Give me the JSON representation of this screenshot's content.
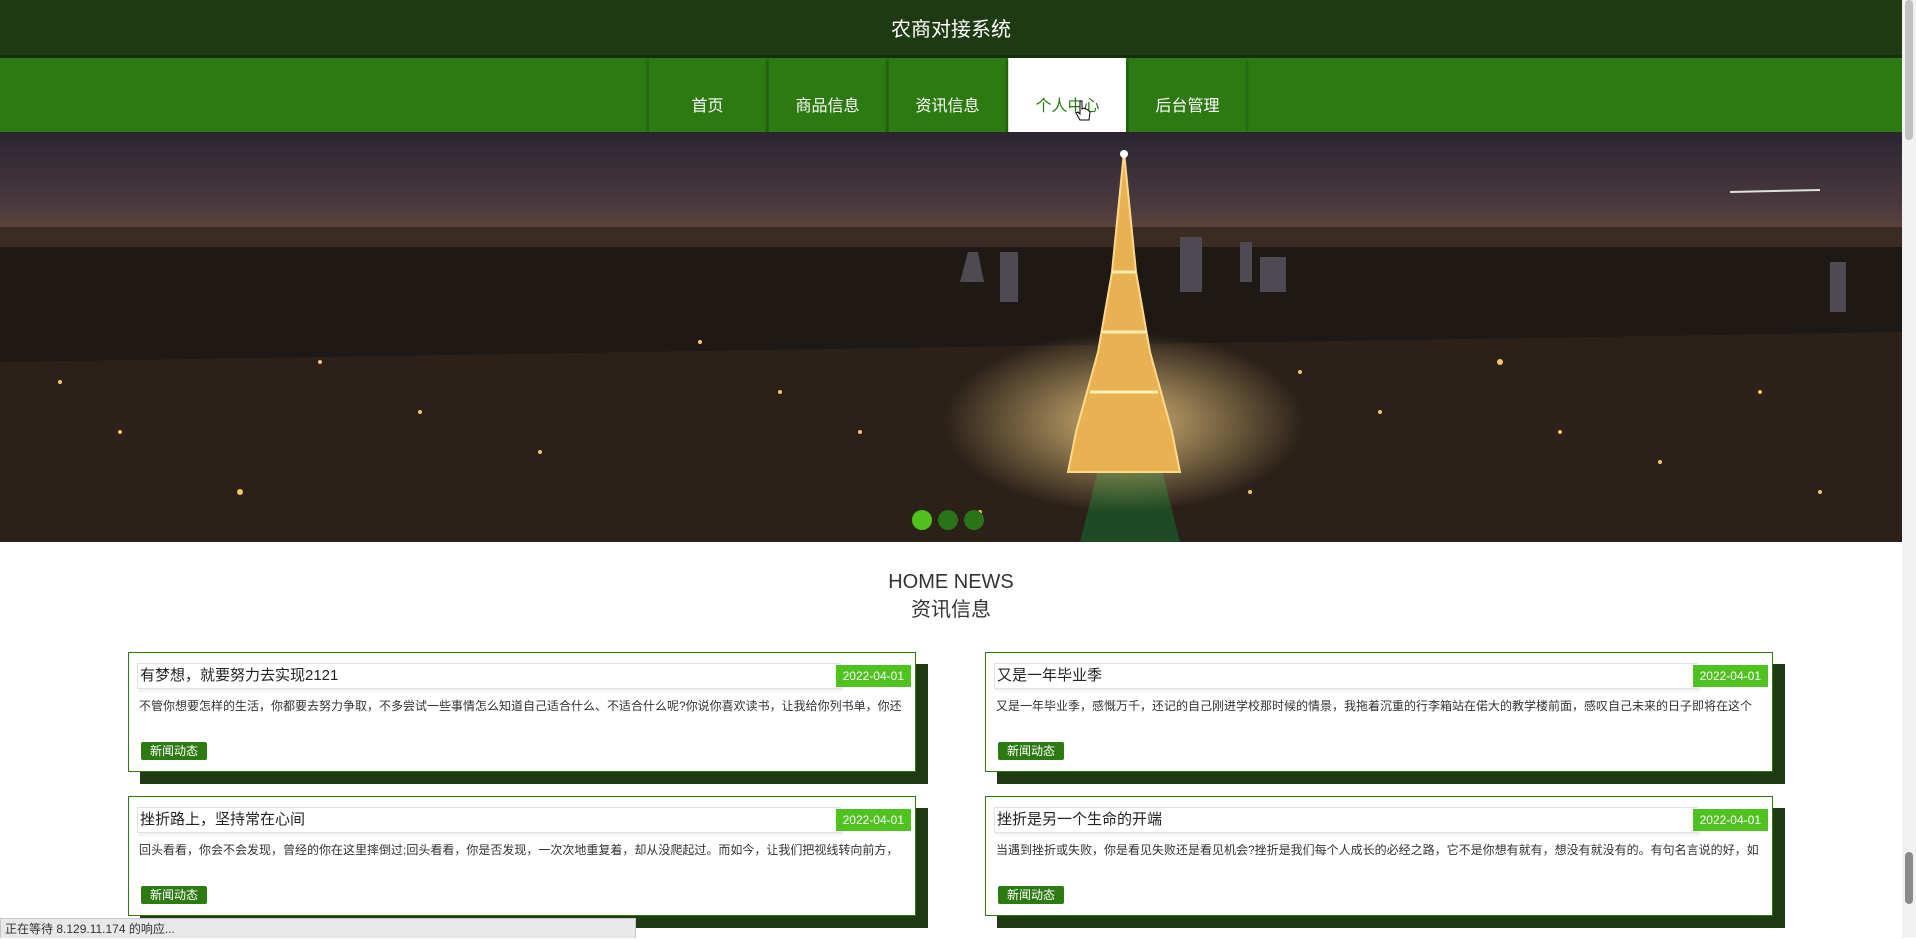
{
  "header": {
    "title": "农商对接系统"
  },
  "nav": {
    "items": [
      {
        "label": "首页"
      },
      {
        "label": "商品信息"
      },
      {
        "label": "资讯信息"
      },
      {
        "label": "个人中心",
        "active": true
      },
      {
        "label": "后台管理"
      }
    ]
  },
  "carousel": {
    "slide_count": 3,
    "active_index": 0
  },
  "section": {
    "title_en": "HOME NEWS",
    "title_cn": "资讯信息"
  },
  "news": [
    {
      "title": "有梦想，就要努力去实现2121",
      "date": "2022-04-01",
      "desc": "不管你想要怎样的生活，你都要去努力争取，不多尝试一些事情怎么知道自己适合什么、不适合什么呢?你说你喜欢读书，让我给你列书单，你还",
      "tag": "新闻动态"
    },
    {
      "title": "又是一年毕业季",
      "date": "2022-04-01",
      "desc": "又是一年毕业季，感慨万千，还记的自己刚进学校那时候的情景，我拖着沉重的行李箱站在偌大的教学楼前面，感叹自己未来的日子即将在这个",
      "tag": "新闻动态"
    },
    {
      "title": "挫折路上，坚持常在心间",
      "date": "2022-04-01",
      "desc": "回头看看，你会不会发现，曾经的你在这里摔倒过;回头看看，你是否发现，一次次地重复着，却从没爬起过。而如今，让我们把视线转向前方，",
      "tag": "新闻动态"
    },
    {
      "title": "挫折是另一个生命的开端",
      "date": "2022-04-01",
      "desc": "当遇到挫折或失败，你是看见失败还是看见机会?挫折是我们每个人成长的必经之路，它不是你想有就有，想没有就没有的。有句名言说的好，如",
      "tag": "新闻动态"
    }
  ],
  "status_bar": {
    "text": "正在等待 8.129.11.174 的响应..."
  },
  "colors": {
    "header_bg": "#1e3a12",
    "nav_bg": "#2d7a12",
    "accent": "#4fc21f"
  }
}
